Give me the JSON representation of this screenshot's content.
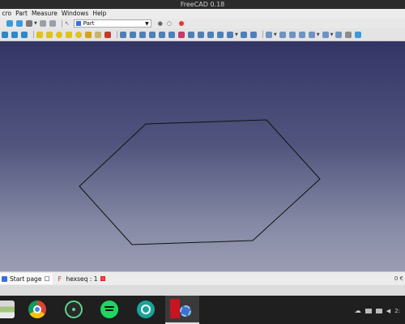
{
  "window": {
    "title": "FreeCAD 0.18"
  },
  "menu": {
    "items": [
      "cro",
      "Part",
      "Measure",
      "Windows",
      "Help"
    ]
  },
  "workbench": {
    "selected": "Part"
  },
  "document_tabs": [
    {
      "label": "Start page"
    },
    {
      "label": "hexseq : 1"
    }
  ],
  "status": {
    "right_text": "0 €"
  },
  "tray": {
    "clock": "2:"
  },
  "sketch": {
    "shape": "hexagon",
    "stroke_color": "#111111"
  },
  "colors": {
    "viewport_top": "#333566",
    "viewport_bottom": "#9a9db3",
    "freecad_red": "#c8141e"
  }
}
